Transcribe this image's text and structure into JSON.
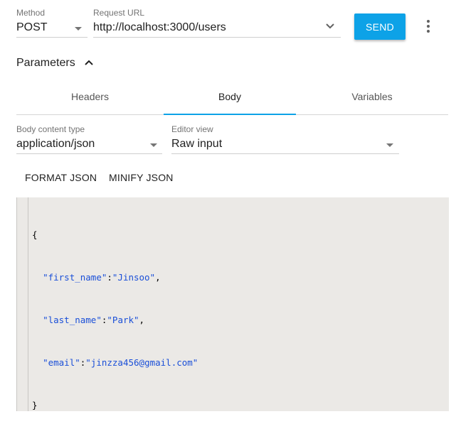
{
  "request": {
    "method_label": "Method",
    "method_value": "POST",
    "url_label": "Request URL",
    "url_value": "http://localhost:3000/users",
    "send_label": "SEND"
  },
  "parameters": {
    "title": "Parameters",
    "tabs": [
      {
        "label": "Headers",
        "active": false
      },
      {
        "label": "Body",
        "active": true
      },
      {
        "label": "Variables",
        "active": false
      }
    ]
  },
  "body": {
    "content_type_label": "Body content type",
    "content_type_value": "application/json",
    "editor_view_label": "Editor view",
    "editor_view_value": "Raw input",
    "format_label": "FORMAT JSON",
    "minify_label": "MINIFY JSON"
  },
  "editor": {
    "lines": [
      {
        "open": "{"
      },
      {
        "key": "\"first_name\"",
        "sep": ":",
        "val": "\"Jinsoo\"",
        "end": ","
      },
      {
        "key": "\"last_name\"",
        "sep": ":",
        "val": "\"Park\"",
        "end": ","
      },
      {
        "key": "\"email\"",
        "sep": ":",
        "val": "\"jinzza456@gmail.com\"",
        "end": ""
      },
      {
        "close": "}"
      }
    ]
  },
  "colors": {
    "accent": "#0da2e7",
    "editor_bg": "#ebe9e6",
    "json_string": "#1a4fd8"
  },
  "icons": [
    "chevron-down-icon",
    "chevron-up-icon",
    "more-vert-icon"
  ]
}
